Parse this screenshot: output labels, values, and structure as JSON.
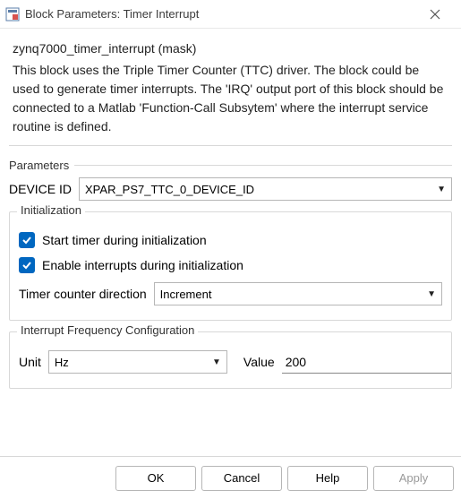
{
  "titlebar": {
    "title": "Block Parameters: Timer Interrupt"
  },
  "mask": {
    "header": "zynq7000_timer_interrupt (mask)",
    "description": "This block uses the Triple Timer Counter (TTC) driver. The block could be used to generate timer interrupts. The 'IRQ' output port of this block should be connected to a Matlab 'Function-Call Subsytem' where the interrupt service routine is defined."
  },
  "parameters": {
    "legend": "Parameters",
    "device_id": {
      "label": "DEVICE ID",
      "value": "XPAR_PS7_TTC_0_DEVICE_ID"
    },
    "initialization": {
      "legend": "Initialization",
      "start_timer": {
        "checked": true,
        "label": "Start timer during initialization"
      },
      "enable_interrupts": {
        "checked": true,
        "label": "Enable interrupts during initialization"
      },
      "timer_direction": {
        "label": "Timer counter direction",
        "value": "Increment"
      }
    },
    "interrupt_freq": {
      "legend": "Interrupt Frequency Configuration",
      "unit": {
        "label": "Unit",
        "value": "Hz"
      },
      "value": {
        "label": "Value",
        "text": "200"
      }
    }
  },
  "buttons": {
    "ok": "OK",
    "cancel": "Cancel",
    "help": "Help",
    "apply": "Apply"
  }
}
